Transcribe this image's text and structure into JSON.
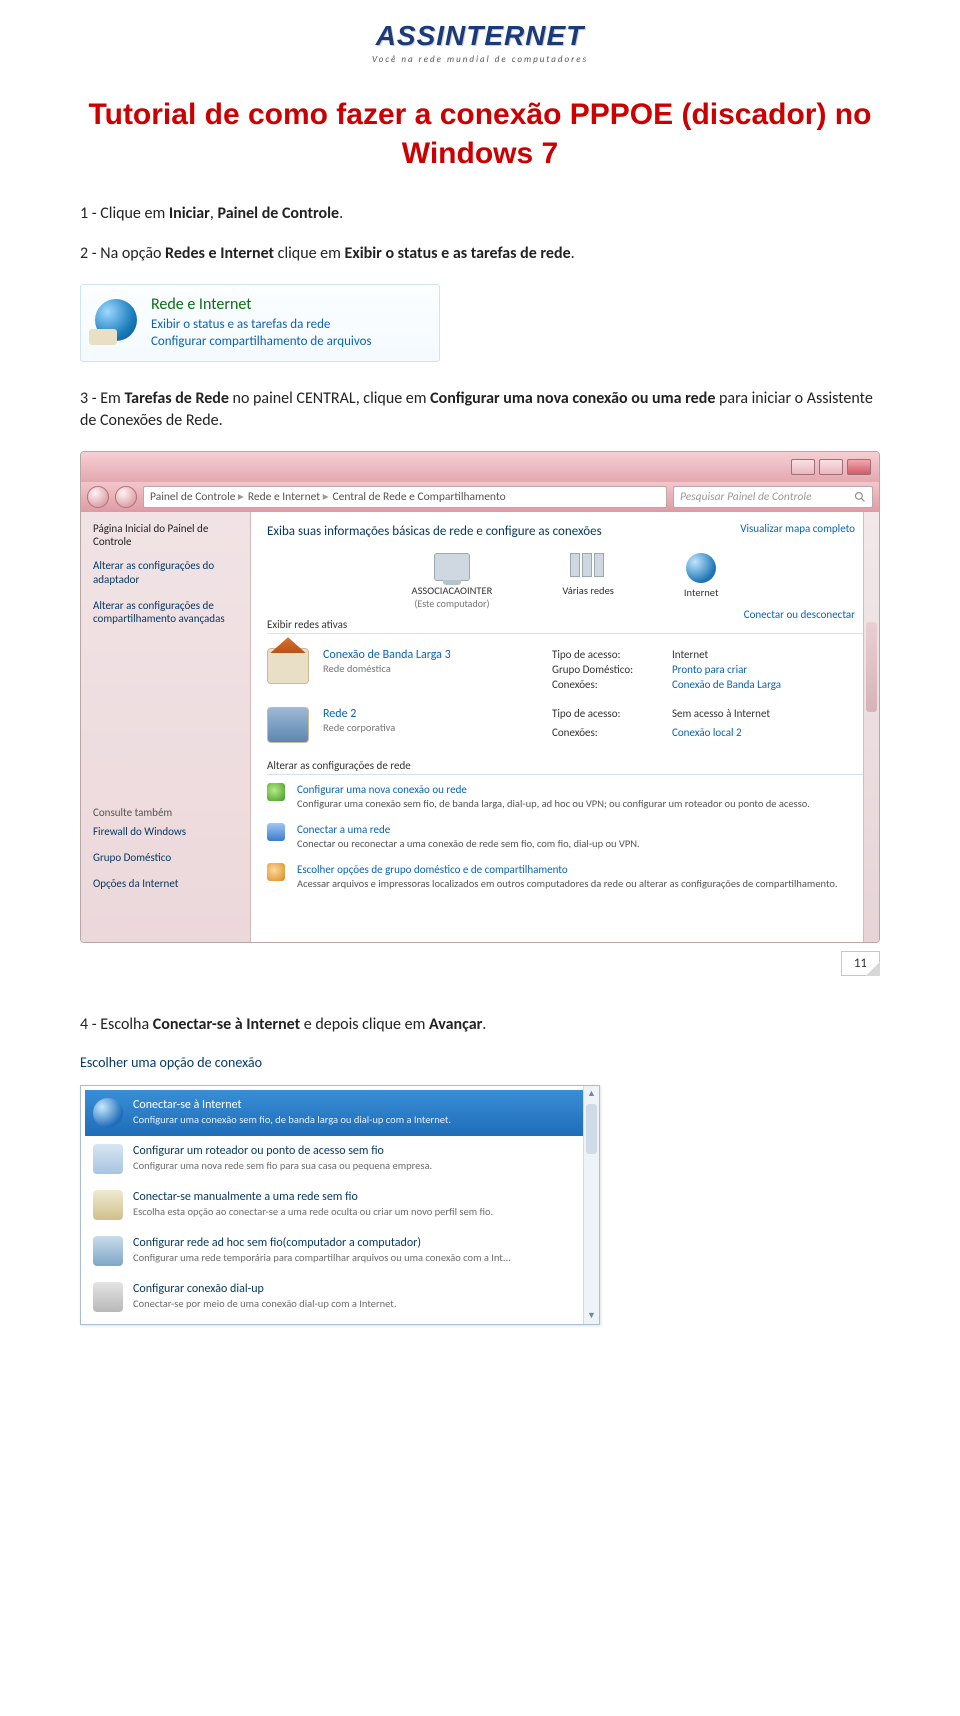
{
  "logo": {
    "name": "ASSINTERNET",
    "tagline": "Você na rede mundial de computadores"
  },
  "title": "Tutorial de como fazer a conexão PPPOE (discador) no Windows 7",
  "steps": {
    "s1_a": "1 - Clique em ",
    "s1_b1": "Iniciar",
    "s1_c": ", ",
    "s1_b2": "Painel de Controle",
    "s1_d": ".",
    "s2_a": "2 - Na opção ",
    "s2_b1": "Redes e Internet",
    "s2_c": " clique em ",
    "s2_b2": "Exibir o status e as tarefas de rede",
    "s2_d": ".",
    "s3_a": "3 - Em ",
    "s3_b1": "Tarefas de Rede",
    "s3_c": " no painel CENTRAL, clique em ",
    "s3_b2": "Configurar uma nova conexão ou uma rede",
    "s3_d": " para iniciar o Assistente de Conexões de Rede.",
    "s4_a": "4 - Escolha ",
    "s4_b1": "Conectar-se à Internet",
    "s4_c": " e depois clique em ",
    "s4_b2": "Avançar",
    "s4_d": "."
  },
  "ss1": {
    "heading": "Rede e Internet",
    "link1": "Exibir o status e as tarefas da rede",
    "link2": "Configurar compartilhamento de arquivos"
  },
  "ss2": {
    "crumbs": [
      "Painel de Controle",
      "Rede e Internet",
      "Central de Rede e Compartilhamento"
    ],
    "search_ph": "Pesquisar Painel de Controle",
    "side": {
      "title": "Página Inicial do Painel de Controle",
      "l1": "Alterar as configurações do adaptador",
      "l2": "Alterar as configurações de compartilhamento avançadas",
      "also": "Consulte também",
      "a1": "Firewall do Windows",
      "a2": "Grupo Doméstico",
      "a3": "Opções da Internet"
    },
    "main": {
      "hdr": "Exiba suas informações básicas de rede e configure as conexões",
      "map_link": "Visualizar mapa completo",
      "conn_link": "Conectar ou desconectar",
      "node1": "ASSOCIACAOINTER",
      "node1_sub": "(Este computador)",
      "node2": "Várias redes",
      "node3": "Internet",
      "active_hdr": "Exibir redes ativas",
      "net1_name": "Conexão de Banda Larga 3",
      "net1_type": "Rede doméstica",
      "kv1_k1": "Tipo de acesso:",
      "kv1_v1": "Internet",
      "kv1_k2": "Grupo Doméstico:",
      "kv1_v2": "Pronto para criar",
      "kv1_k3": "Conexões:",
      "kv1_v3": "Conexão de Banda Larga",
      "net2_name": "Rede 2",
      "net2_type": "Rede corporativa",
      "kv2_k1": "Tipo de acesso:",
      "kv2_v1": "Sem acesso à Internet",
      "kv2_k2": "Conexões:",
      "kv2_v2": "Conexão local 2",
      "cfg_hdr": "Alterar as configurações de rede",
      "cfg1_t": "Configurar uma nova conexão ou rede",
      "cfg1_d": "Configurar uma conexão sem fio, de banda larga, dial-up, ad hoc ou VPN; ou configurar um roteador ou ponto de acesso.",
      "cfg2_t": "Conectar a uma rede",
      "cfg2_d": "Conectar ou reconectar a uma conexão de rede sem fio, com fio, dial-up ou VPN.",
      "cfg3_t": "Escolher opções de grupo doméstico e de compartilhamento",
      "cfg3_d": "Acessar arquivos e impressoras localizados em outros computadores da rede ou alterar as configurações de compartilhamento."
    }
  },
  "page_number": "11",
  "ss3": {
    "hdr": "Escolher uma opção de conexão",
    "opts": [
      {
        "t": "Conectar-se à Internet",
        "d": "Configurar uma conexão sem fio, de banda larga ou dial-up com a Internet."
      },
      {
        "t": "Configurar um roteador ou ponto de acesso sem fio",
        "d": "Configurar uma nova rede sem fio para sua casa ou pequena empresa."
      },
      {
        "t": "Conectar-se manualmente a uma rede sem fio",
        "d": "Escolha esta opção ao conectar-se a uma rede oculta ou criar um novo perfil sem fio."
      },
      {
        "t": "Configurar rede ad hoc sem fio(computador a computador)",
        "d": "Configurar uma rede temporária para compartilhar arquivos ou uma conexão com a Int..."
      },
      {
        "t": "Configurar conexão dial-up",
        "d": "Conectar-se por meio de uma conexão dial-up com a Internet."
      }
    ]
  }
}
